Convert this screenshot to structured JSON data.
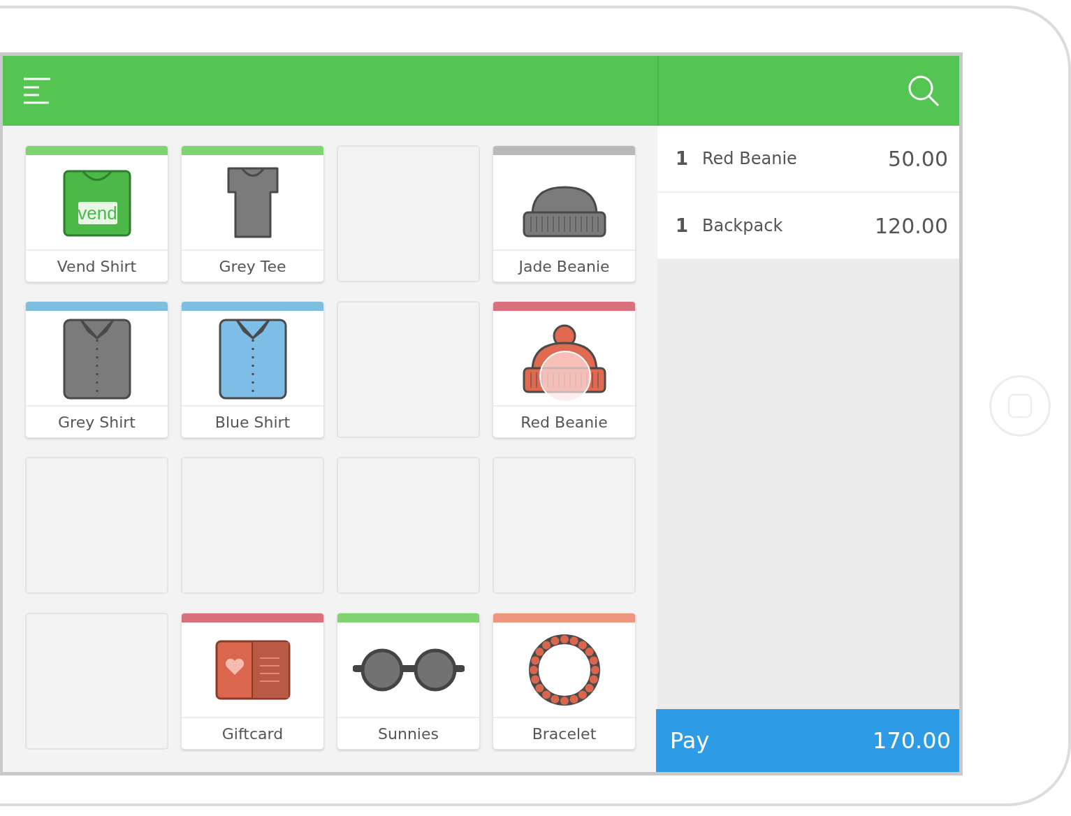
{
  "products": [
    {
      "kind": "product",
      "name": "Vend Shirt",
      "color": "#7ed56f",
      "logo_text": "vend",
      "touched": false
    },
    {
      "kind": "product",
      "name": "Grey Tee",
      "color": "#7ed56f",
      "touched": false
    },
    {
      "kind": "empty"
    },
    {
      "kind": "product",
      "name": "Jade Beanie",
      "color": "#b9b9b9",
      "touched": false
    },
    {
      "kind": "product",
      "name": "Grey Shirt",
      "color": "#7ebfe0",
      "touched": false
    },
    {
      "kind": "product",
      "name": "Blue Shirt",
      "color": "#7ebfe0",
      "touched": false
    },
    {
      "kind": "empty"
    },
    {
      "kind": "product",
      "name": "Red Beanie",
      "color": "#d9707e",
      "touched": true
    },
    {
      "kind": "empty"
    },
    {
      "kind": "empty"
    },
    {
      "kind": "empty"
    },
    {
      "kind": "empty"
    },
    {
      "kind": "empty"
    },
    {
      "kind": "product",
      "name": "Giftcard",
      "color": "#d9707e",
      "touched": false
    },
    {
      "kind": "product",
      "name": "Sunnies",
      "color": "#7ed56f",
      "touched": false
    },
    {
      "kind": "product",
      "name": "Bracelet",
      "color": "#ef957c",
      "touched": false
    }
  ],
  "cart": [
    {
      "qty": "1",
      "name": "Red Beanie",
      "price": "50.00"
    },
    {
      "qty": "1",
      "name": "Backpack",
      "price": "120.00"
    }
  ],
  "pay": {
    "label": "Pay",
    "total": "170.00"
  }
}
